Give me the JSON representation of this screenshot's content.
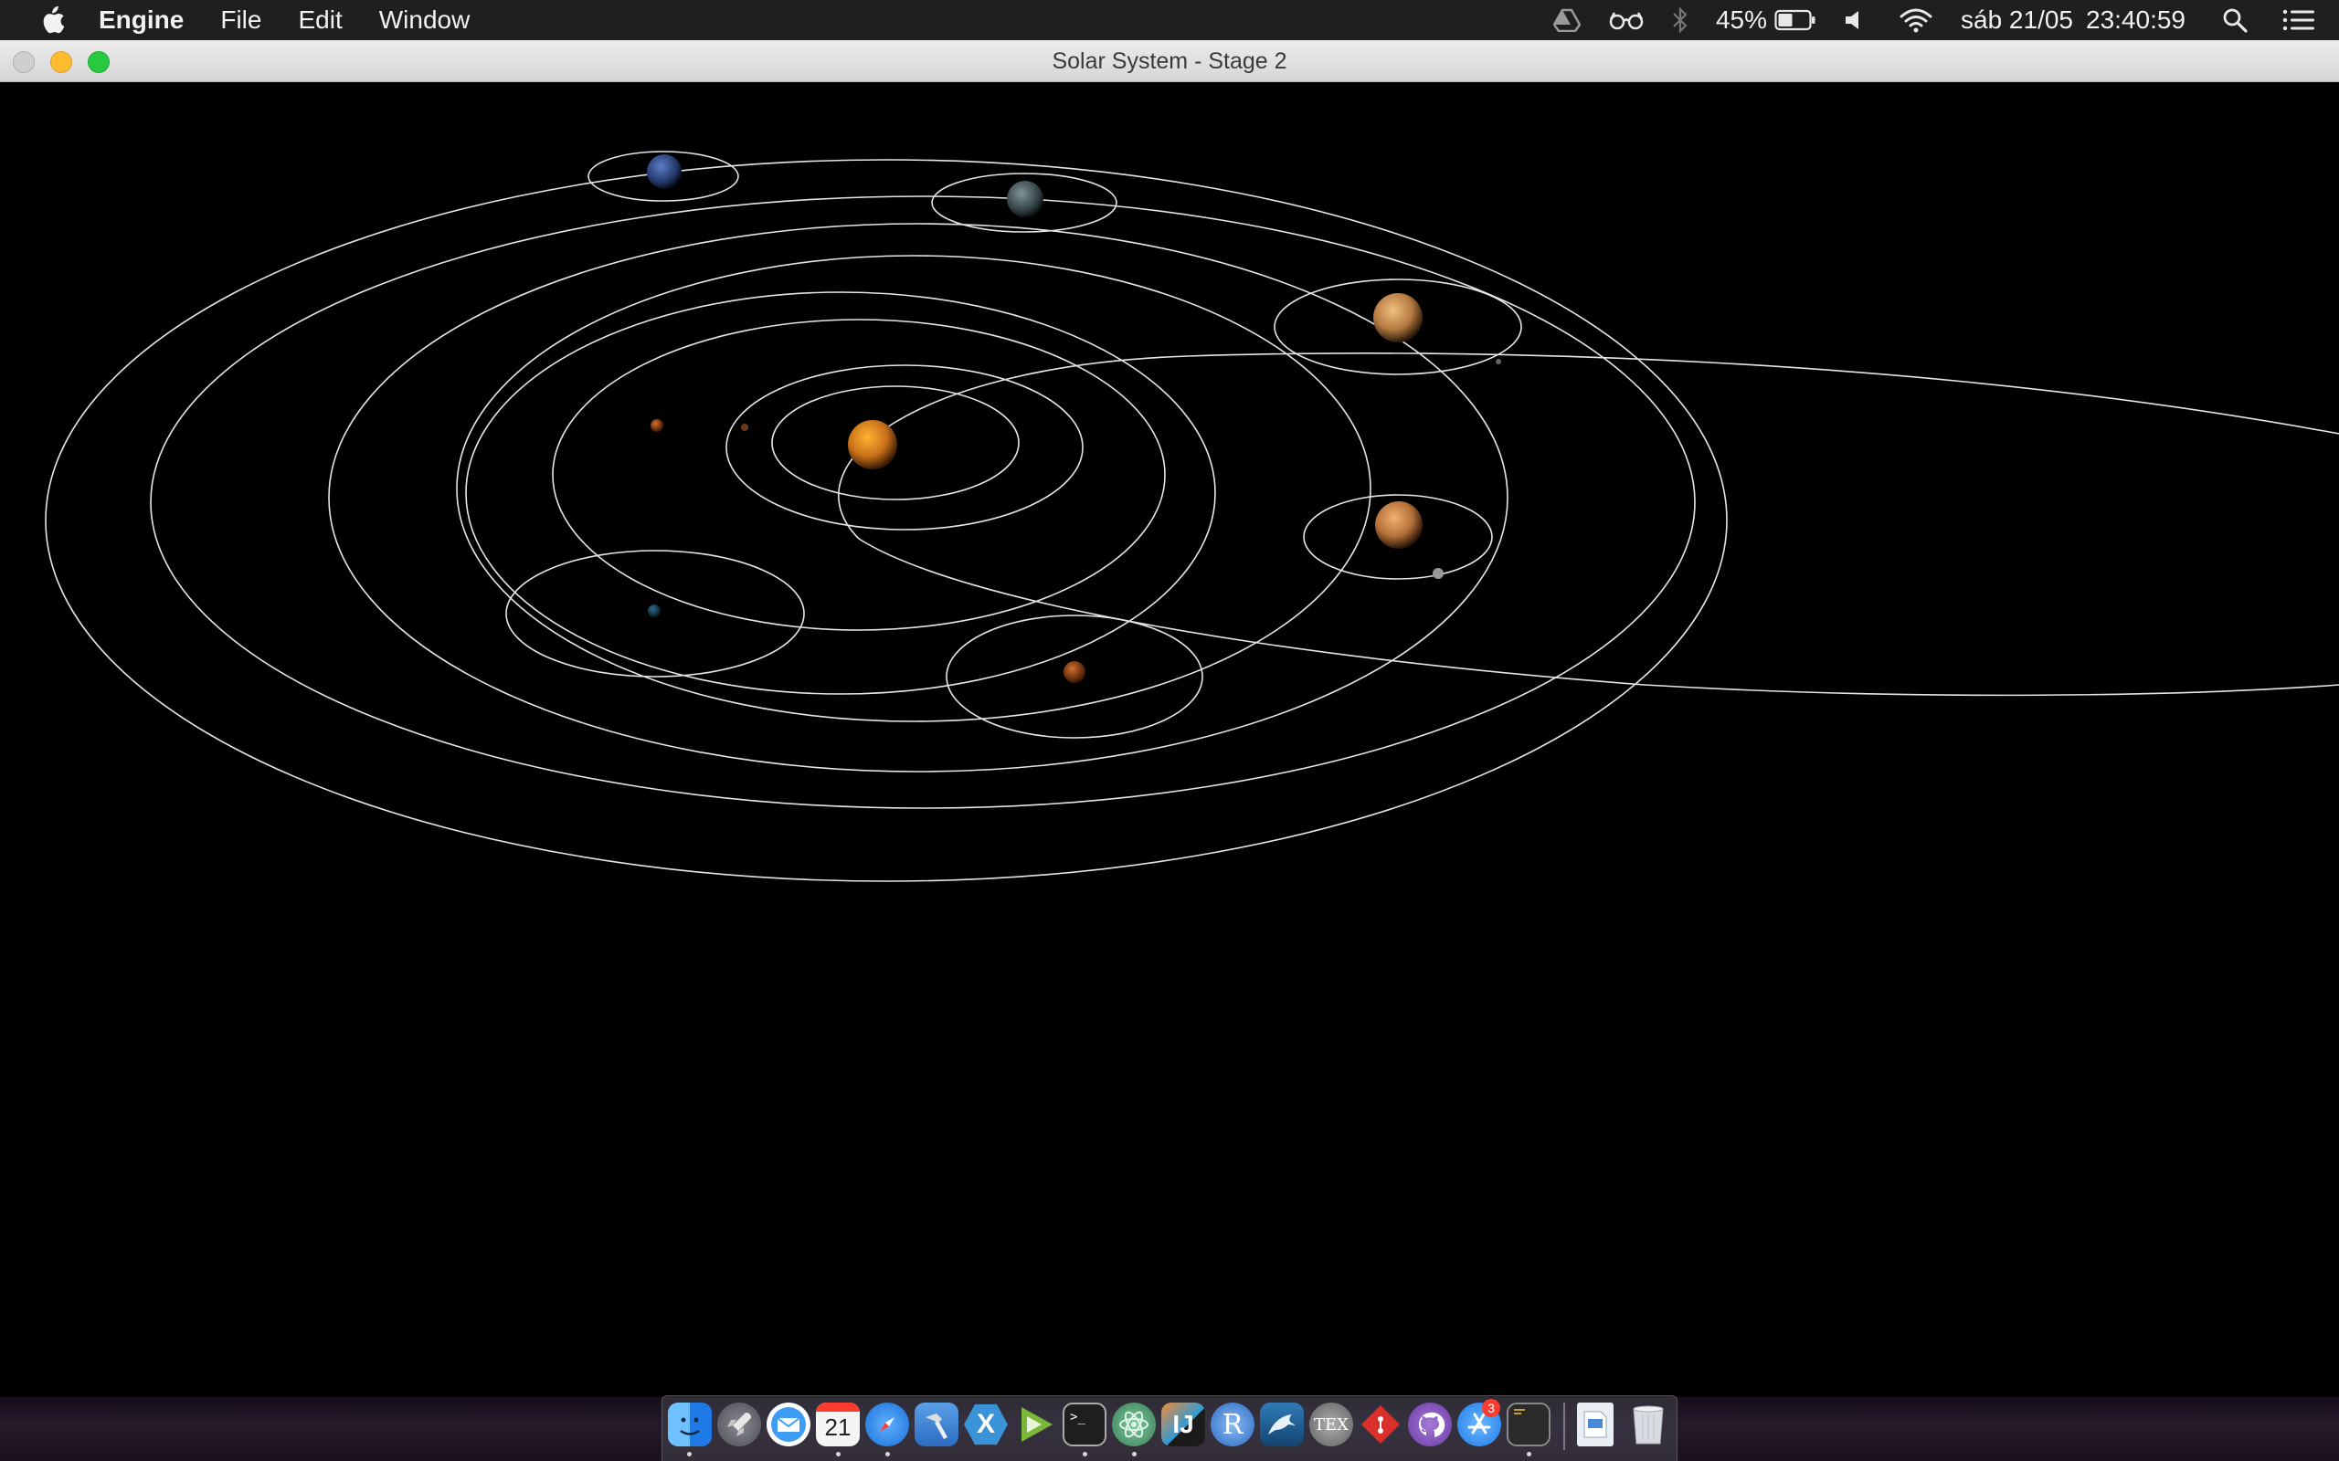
{
  "menubar": {
    "app_name": "Engine",
    "items": [
      "File",
      "Edit",
      "Window"
    ],
    "battery_percent": "45%",
    "date": "sáb 21/05",
    "time": "23:40:59",
    "icons": [
      "apple-icon",
      "google-drive-icon",
      "glasses-icon",
      "bluetooth-icon",
      "battery-icon",
      "volume-icon",
      "wifi-icon",
      "spotlight-search-icon",
      "notification-center-icon"
    ]
  },
  "window": {
    "title": "Solar System - Stage 2"
  },
  "scene": {
    "background": "#000000",
    "orbit_color": "#e6e6e6",
    "bodies": [
      {
        "name": "sun",
        "color": "#d98a1a"
      },
      {
        "name": "mercury",
        "color": "#8a4a22"
      },
      {
        "name": "venus",
        "color": "#a0521e"
      },
      {
        "name": "earth",
        "color": "#23506e"
      },
      {
        "name": "mars",
        "color": "#a8481d"
      },
      {
        "name": "jupiter",
        "color": "#c58a4a"
      },
      {
        "name": "saturn",
        "color": "#c68a4a"
      },
      {
        "name": "uranus",
        "color": "#6a7f86"
      },
      {
        "name": "neptune",
        "color": "#2e4a86"
      }
    ]
  },
  "dock": {
    "apps": [
      {
        "name": "finder",
        "icon": "finder-icon",
        "color": "#2f8cf0",
        "running": true
      },
      {
        "name": "launchpad",
        "icon": "rocket-icon",
        "color": "#6c6c74",
        "running": false
      },
      {
        "name": "mail",
        "icon": "mail-icon",
        "color": "#3f9cf5",
        "running": false
      },
      {
        "name": "calendar",
        "icon": "calendar-icon",
        "color": "#f5f5f5",
        "running": true,
        "label": "21"
      },
      {
        "name": "safari",
        "icon": "safari-compass-icon",
        "color": "#2a8df3",
        "running": true
      },
      {
        "name": "xcode-instruments",
        "icon": "hammer-icon",
        "color": "#3b7fd4",
        "running": false
      },
      {
        "name": "xamarin",
        "icon": "x-hexagon-icon",
        "color": "#3a93d6",
        "running": false
      },
      {
        "name": "play",
        "icon": "play-icon",
        "color": "#7ab73a",
        "running": false
      },
      {
        "name": "terminal",
        "icon": "terminal-icon",
        "color": "#1e1e1e",
        "running": true
      },
      {
        "name": "atom",
        "icon": "atom-icon",
        "color": "#55a07a",
        "running": true
      },
      {
        "name": "intellij",
        "icon": "intellij-icon",
        "color": "#2e9ad6",
        "running": false
      },
      {
        "name": "r",
        "icon": "r-icon",
        "color": "#2a6ac4",
        "running": false
      },
      {
        "name": "mysql-workbench",
        "icon": "dolphin-icon",
        "color": "#1f5b8c",
        "running": false
      },
      {
        "name": "tex",
        "icon": "tex-icon",
        "color": "#7a7a7a",
        "running": false
      },
      {
        "name": "git-kraken",
        "icon": "diamond-icon",
        "color": "#d9302c",
        "running": false
      },
      {
        "name": "github",
        "icon": "github-icon",
        "color": "#8e5bc4",
        "running": false
      },
      {
        "name": "app-store",
        "icon": "app-store-icon",
        "color": "#2f8cf0",
        "running": false,
        "badge": "3"
      },
      {
        "name": "console",
        "icon": "console-icon",
        "color": "#2b2b2b",
        "running": true
      },
      {
        "name": "saver-file",
        "icon": "document-icon",
        "color": "#e9eef5",
        "running": false
      },
      {
        "name": "trash",
        "icon": "trash-icon",
        "color": "#d8dbe0",
        "running": false
      }
    ]
  }
}
